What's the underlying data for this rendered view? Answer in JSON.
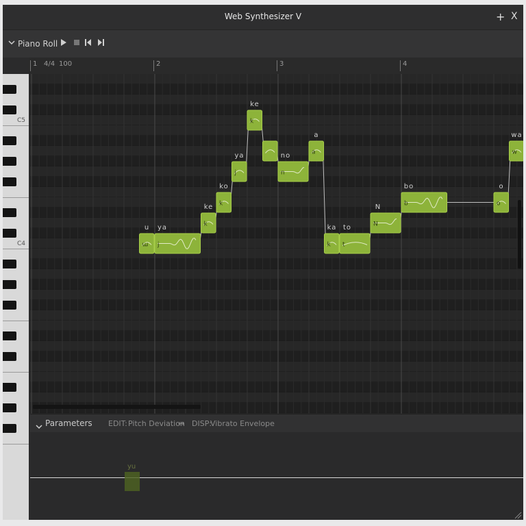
{
  "window": {
    "title": "Web Synthesizer V",
    "add_label": "+",
    "close_label": "X"
  },
  "toolbar": {
    "panel_label": "Piano Roll",
    "collapse_icon": "chevron-down-icon"
  },
  "ruler": {
    "bar1": "1",
    "time_sig": "4/4",
    "tempo": "100",
    "bar2": "2",
    "bar3": "3",
    "bar4": "4"
  },
  "keys": {
    "c5": "C5",
    "c4": "C4"
  },
  "notes": [
    {
      "lyric": "u",
      "phoneme": "ɯ",
      "start": 1.875,
      "dur": 0.125,
      "pitch": 60,
      "vibrato": false
    },
    {
      "lyric": "ya",
      "phoneme": "ja",
      "start": 2.0,
      "dur": 0.375,
      "pitch": 60,
      "vibrato": true
    },
    {
      "lyric": "ke",
      "phoneme": "ke",
      "start": 2.375,
      "dur": 0.125,
      "pitch": 62,
      "vibrato": false
    },
    {
      "lyric": "ko",
      "phoneme": "ko",
      "start": 2.5,
      "dur": 0.125,
      "pitch": 64,
      "vibrato": false
    },
    {
      "lyric": "ya",
      "phoneme": "ja",
      "start": 2.625,
      "dur": 0.125,
      "pitch": 67,
      "vibrato": false
    },
    {
      "lyric": "ke",
      "phoneme": "ke",
      "start": 2.75,
      "dur": 0.125,
      "pitch": 72,
      "vibrato": false
    },
    {
      "lyric": "",
      "phoneme": "",
      "start": 2.875,
      "dur": 0.125,
      "pitch": 69,
      "vibrato": false
    },
    {
      "lyric": "no",
      "phoneme": "no",
      "start": 3.0,
      "dur": 0.25,
      "pitch": 67,
      "vibrato": true
    },
    {
      "lyric": "a",
      "phoneme": "a",
      "start": 3.25,
      "dur": 0.125,
      "pitch": 69,
      "vibrato": false
    },
    {
      "lyric": "ka",
      "phoneme": "ka",
      "start": 3.375,
      "dur": 0.125,
      "pitch": 60,
      "vibrato": false
    },
    {
      "lyric": "to",
      "phoneme": "to",
      "start": 3.5,
      "dur": 0.25,
      "pitch": 60,
      "vibrato": false
    },
    {
      "lyric": "N",
      "phoneme": "N",
      "start": 3.75,
      "dur": 0.25,
      "pitch": 62,
      "vibrato": true
    },
    {
      "lyric": "bo",
      "phoneme": "bo",
      "start": 4.0,
      "dur": 0.375,
      "pitch": 64,
      "vibrato": true
    },
    {
      "lyric": "o",
      "phoneme": "o",
      "start": 4.75,
      "dur": 0.125,
      "pitch": 64,
      "vibrato": false
    },
    {
      "lyric": "wa",
      "phoneme": "wa",
      "start": 4.875,
      "dur": 0.125,
      "pitch": 69,
      "vibrato": false
    }
  ],
  "params": {
    "panel_label": "Parameters",
    "edit_label": "EDIT:",
    "edit_value": "Pitch Deviation",
    "disp_label": "DISP:",
    "disp_value": "Vibrato Envelope",
    "ghost_lyric": "yu"
  },
  "colors": {
    "note_fill": "#8db33a",
    "note_border": "#a8cf4a",
    "grid_bg": "#232323",
    "accent": "#8db33a"
  }
}
